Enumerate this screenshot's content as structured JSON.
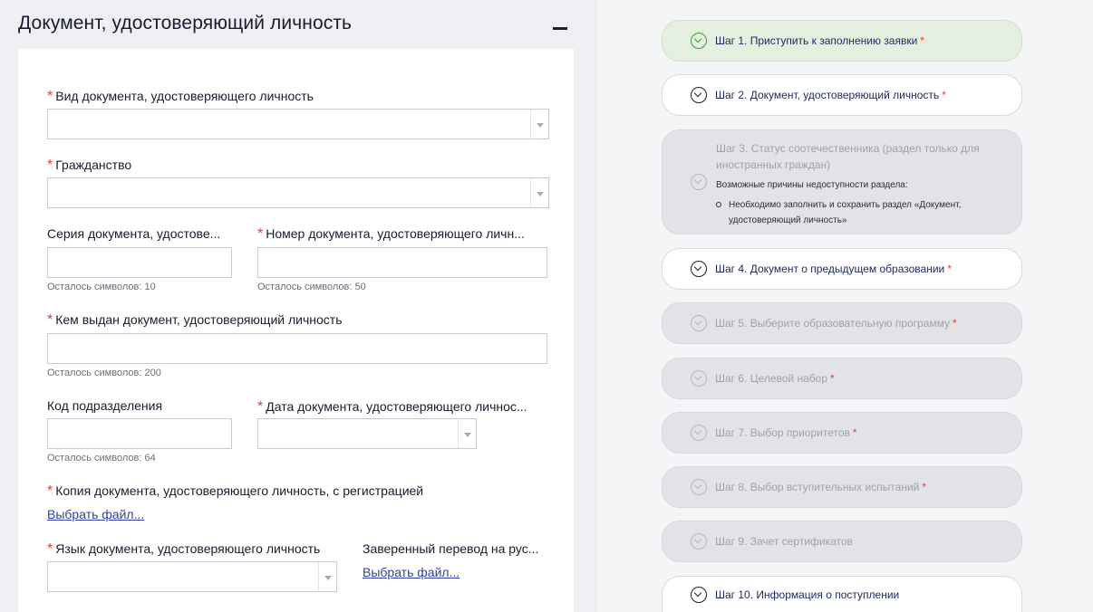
{
  "section": {
    "title": "Документ, удостоверяющий личность"
  },
  "form": {
    "required_mark": "*",
    "doc_type": {
      "label": "Вид документа, удостоверяющего личность",
      "value": ""
    },
    "citizenship": {
      "label": "Гражданство",
      "value": ""
    },
    "doc_series": {
      "label": "Серия документа, удостове...",
      "value": "",
      "hint": "Осталось символов: 10"
    },
    "doc_number": {
      "label": "Номер документа, удостоверяющего личн...",
      "value": "",
      "hint": "Осталось символов: 50"
    },
    "issued_by": {
      "label": "Кем выдан документ, удостоверяющий личность",
      "value": "",
      "hint": "Осталось символов: 200"
    },
    "division_code": {
      "label": "Код подразделения",
      "value": "",
      "hint": "Осталось символов: 64"
    },
    "doc_date": {
      "label": "Дата документа, удостоверяющего личнос...",
      "value": ""
    },
    "doc_copy": {
      "label": "Копия документа, удостоверяющего личность, с регистрацией",
      "link": "Выбрать файл..."
    },
    "doc_language": {
      "label": "Язык документа, удостоверяющего личность",
      "value": ""
    },
    "translation": {
      "label": "Заверенный перевод на рус...",
      "link": "Выбрать файл..."
    }
  },
  "steps": [
    {
      "label": "Шаг 1. Приступить к заполнению заявки",
      "required": "*",
      "state": "done"
    },
    {
      "label": "Шаг 2. Документ, удостоверяющий личность",
      "required": "*",
      "state": "active"
    },
    {
      "label": "Шаг 3. Статус соотечественника (раздел только для иностранных граждан)",
      "state": "disabled",
      "reasons_title": "Возможные причины недоступности раздела:",
      "reasons": [
        "Необходимо заполнить и сохранить раздел «Документ, удостоверяющий личность»"
      ]
    },
    {
      "label": "Шаг 4. Документ о предыдущем образовании",
      "required": "*",
      "state": "active"
    },
    {
      "label": "Шаг 5. Выберите образовательную программу",
      "required": "*",
      "state": "disabled"
    },
    {
      "label": "Шаг 6. Целевой набор",
      "required": "*",
      "state": "disabled"
    },
    {
      "label": "Шаг 7. Выбор приоритетов",
      "required": "*",
      "state": "disabled"
    },
    {
      "label": "Шаг 8. Выбор вступительных испытаний",
      "required": "*",
      "state": "disabled"
    },
    {
      "label": "Шаг 9. Зачет сертификатов",
      "required": "",
      "state": "disabled"
    },
    {
      "label": "Шаг 10. Информация о поступлении",
      "required": "",
      "state": "active"
    }
  ]
}
